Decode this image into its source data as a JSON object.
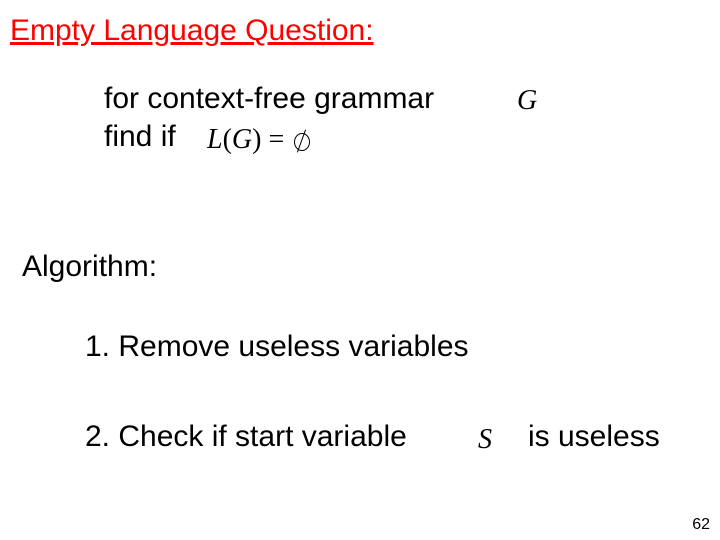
{
  "title": "Empty Language Question:",
  "line1": "for context-free grammar",
  "line2": "find if",
  "math": {
    "G": "G",
    "LG_prefix": "L",
    "LG_open": "(",
    "LG_var": "G",
    "LG_close": ")",
    "eq": " = ",
    "S": "S"
  },
  "algorithm_label": "Algorithm:",
  "step1": "1. Remove useless variables",
  "step2_a": "2. Check if start variable",
  "step2_b": "is useless",
  "page_number": "62"
}
